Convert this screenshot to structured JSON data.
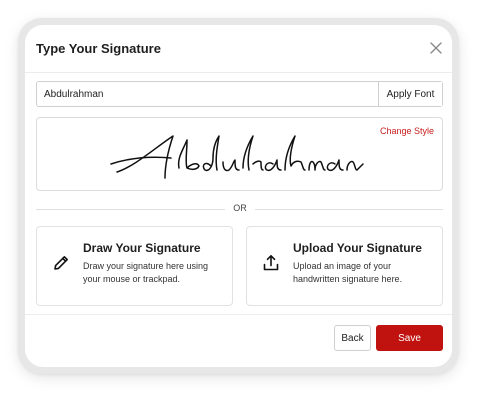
{
  "dialog": {
    "title": "Type Your Signature",
    "close_icon": "close-icon"
  },
  "name_input": {
    "value": "Abdulrahman",
    "apply_label": "Apply Font"
  },
  "preview": {
    "signature_text": "Abdulrahman",
    "change_style_label": "Change Style"
  },
  "divider": {
    "label": "OR"
  },
  "options": {
    "draw": {
      "icon": "pencil-icon",
      "title": "Draw Your Signature",
      "description": "Draw your signature here using your mouse or trackpad."
    },
    "upload": {
      "icon": "upload-icon",
      "title": "Upload Your Signature",
      "description": "Upload an image of your handwritten signature here."
    }
  },
  "footer": {
    "back_label": "Back",
    "save_label": "Save"
  },
  "colors": {
    "accent": "#c0120f",
    "link": "#c8201f"
  }
}
